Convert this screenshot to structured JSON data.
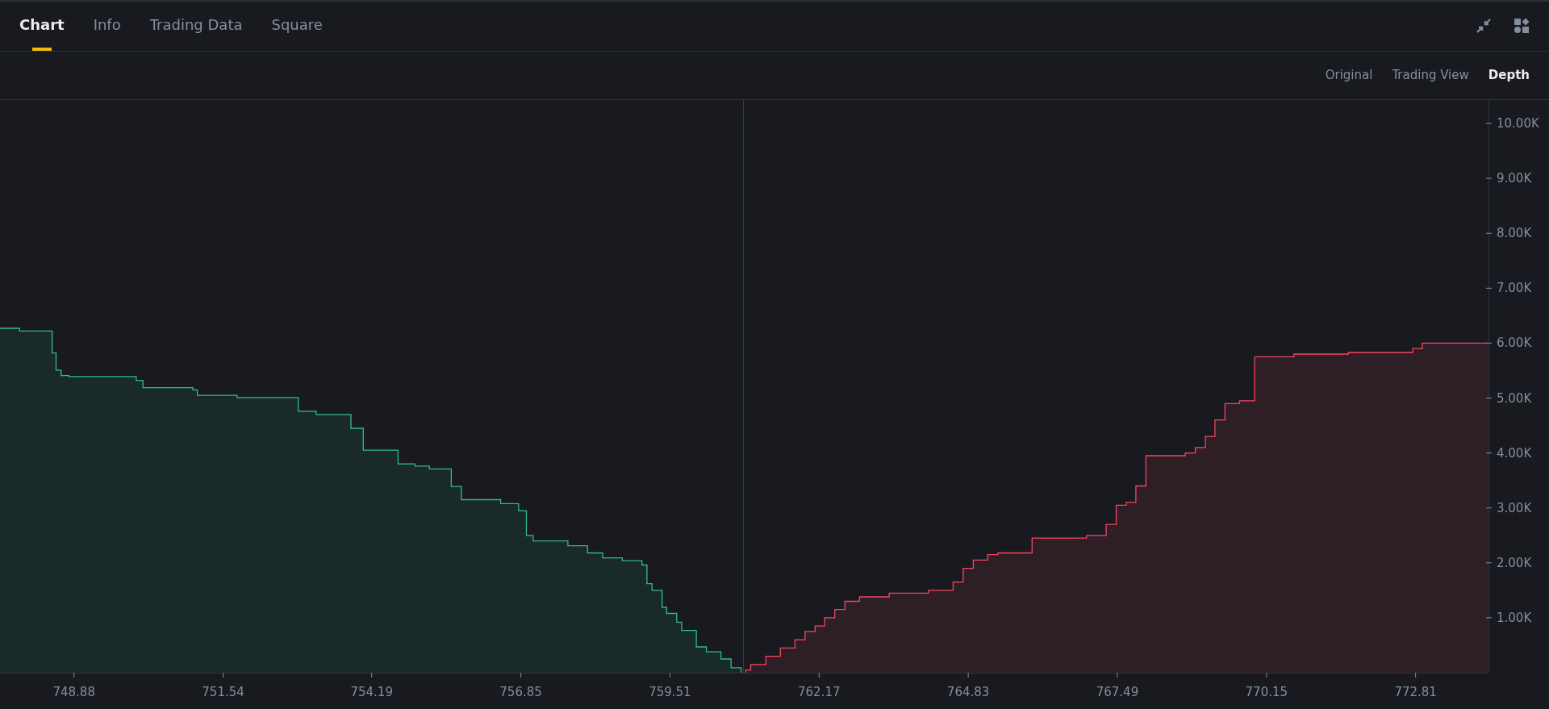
{
  "tabs": [
    {
      "label": "Chart",
      "selected": true
    },
    {
      "label": "Info",
      "selected": false
    },
    {
      "label": "Trading Data",
      "selected": false
    },
    {
      "label": "Square",
      "selected": false
    }
  ],
  "view_options": [
    {
      "label": "Original",
      "selected": false
    },
    {
      "label": "Trading View",
      "selected": false
    },
    {
      "label": "Depth",
      "selected": true
    }
  ],
  "chart_data": {
    "type": "area",
    "xlim": [
      747.56,
      774.11
    ],
    "ylim": [
      0,
      10426
    ],
    "ref_lines": [
      {
        "axis": "x",
        "value": 760.82
      }
    ],
    "x": [
      747.56,
      747.91,
      747.91,
      748.49,
      748.49,
      748.56,
      748.56,
      748.65,
      748.65,
      748.79,
      748.79,
      749.99,
      749.99,
      750.11,
      750.11,
      751.0,
      751.0,
      751.08,
      751.08,
      751.79,
      751.79,
      752.88,
      752.88,
      753.2,
      753.2,
      753.82,
      753.82,
      754.04,
      754.04,
      754.66,
      754.66,
      754.96,
      754.96,
      755.22,
      755.22,
      755.61,
      755.61,
      755.79,
      755.79,
      756.49,
      756.49,
      756.81,
      756.81,
      756.95,
      756.95,
      757.07,
      757.07,
      757.69,
      757.69,
      758.04,
      758.04,
      758.31,
      758.31,
      758.66,
      758.66,
      759.01,
      759.01,
      759.1,
      759.1,
      759.19,
      759.19,
      759.37,
      759.37,
      759.45,
      759.45,
      759.63,
      759.63,
      759.72,
      759.72,
      759.98,
      759.98,
      760.16,
      760.16,
      760.42,
      760.42,
      760.6,
      760.6,
      760.78,
      760.78,
      760.86,
      760.86,
      760.95,
      760.95,
      761.22,
      761.22,
      761.48,
      761.48,
      761.74,
      761.74,
      761.92,
      761.92,
      762.1,
      762.1,
      762.27,
      762.27,
      762.45,
      762.45,
      762.63,
      762.63,
      762.89,
      762.89,
      763.42,
      763.42,
      764.12,
      764.12,
      764.56,
      764.56,
      764.74,
      764.74,
      764.92,
      764.92,
      765.18,
      765.18,
      765.36,
      765.36,
      765.97,
      765.97,
      766.94,
      766.94,
      767.29,
      767.29,
      767.47,
      767.47,
      767.65,
      767.65,
      767.82,
      767.82,
      768.0,
      768.0,
      768.7,
      768.7,
      768.88,
      768.88,
      769.06,
      769.06,
      769.23,
      769.23,
      769.41,
      769.41,
      769.67,
      769.67,
      769.94,
      769.94,
      770.64,
      770.64,
      771.61,
      771.61,
      772.76,
      772.76,
      772.93,
      772.93,
      774.11
    ],
    "series": [
      {
        "color": "#2ebd85",
        "values": [
          6270,
          6270,
          6220,
          6220,
          5820,
          5820,
          5510,
          5510,
          5410,
          5410,
          5390,
          5390,
          5320,
          5320,
          5190,
          5190,
          5150,
          5150,
          5050,
          5050,
          5010,
          5010,
          4760,
          4760,
          4700,
          4700,
          4450,
          4450,
          4050,
          4050,
          3800,
          3800,
          3760,
          3760,
          3710,
          3710,
          3390,
          3390,
          3150,
          3150,
          3080,
          3080,
          2950,
          2950,
          2500,
          2500,
          2400,
          2400,
          2310,
          2310,
          2180,
          2180,
          2090,
          2090,
          2040,
          2040,
          1960,
          1960,
          1620,
          1620,
          1500,
          1500,
          1190,
          1190,
          1080,
          1080,
          920,
          920,
          770,
          770,
          470,
          470,
          380,
          380,
          250,
          250,
          90,
          90,
          0,
          null,
          null,
          null,
          null,
          null,
          null,
          null,
          null,
          null,
          null,
          null,
          null,
          null,
          null,
          null,
          null,
          null,
          null,
          null,
          null,
          null,
          null,
          null,
          null,
          null,
          null,
          null,
          null,
          null,
          null,
          null,
          null,
          null,
          null,
          null,
          null,
          null,
          null,
          null,
          null,
          null,
          null,
          null,
          null,
          null,
          null,
          null,
          null,
          null,
          null,
          null,
          null,
          null,
          null,
          null,
          null,
          null,
          null,
          null,
          null,
          null,
          null,
          null,
          null,
          null,
          null,
          null,
          null,
          null,
          null,
          null,
          null,
          null
        ]
      },
      {
        "color": "#f6465d",
        "values": [
          null,
          null,
          null,
          null,
          null,
          null,
          null,
          null,
          null,
          null,
          null,
          null,
          null,
          null,
          null,
          null,
          null,
          null,
          null,
          null,
          null,
          null,
          null,
          null,
          null,
          null,
          null,
          null,
          null,
          null,
          null,
          null,
          null,
          null,
          null,
          null,
          null,
          null,
          null,
          null,
          null,
          null,
          null,
          null,
          null,
          null,
          null,
          null,
          null,
          null,
          null,
          null,
          null,
          null,
          null,
          null,
          null,
          null,
          null,
          null,
          null,
          null,
          null,
          null,
          null,
          null,
          null,
          null,
          null,
          null,
          null,
          null,
          null,
          null,
          null,
          null,
          null,
          null,
          null,
          0,
          50,
          50,
          150,
          150,
          300,
          300,
          450,
          450,
          600,
          600,
          750,
          750,
          850,
          850,
          1000,
          1000,
          1150,
          1150,
          1300,
          1300,
          1380,
          1380,
          1450,
          1450,
          1500,
          1500,
          1650,
          1650,
          1900,
          1900,
          2050,
          2050,
          2150,
          2150,
          2180,
          2180,
          2450,
          2450,
          2500,
          2500,
          2700,
          2700,
          3050,
          3050,
          3100,
          3100,
          3400,
          3400,
          3950,
          3950,
          4000,
          4000,
          4100,
          4100,
          4300,
          4300,
          4600,
          4600,
          4900,
          4900,
          4950,
          4950,
          5750,
          5750,
          5800,
          5800,
          5830,
          5830,
          5900,
          5900,
          6000,
          6000
        ]
      }
    ],
    "xticks": [
      748.88,
      751.54,
      754.19,
      756.85,
      759.51,
      762.17,
      764.83,
      767.49,
      770.15,
      772.81
    ],
    "yticks": [
      {
        "value": 1000,
        "label": "1.00K"
      },
      {
        "value": 2000,
        "label": "2.00K"
      },
      {
        "value": 3000,
        "label": "3.00K"
      },
      {
        "value": 4000,
        "label": "4.00K"
      },
      {
        "value": 5000,
        "label": "5.00K"
      },
      {
        "value": 6000,
        "label": "6.00K"
      },
      {
        "value": 7000,
        "label": "7.00K"
      },
      {
        "value": 8000,
        "label": "8.00K"
      },
      {
        "value": 9000,
        "label": "9.00K"
      },
      {
        "value": 10000,
        "label": "10.00K"
      }
    ]
  }
}
